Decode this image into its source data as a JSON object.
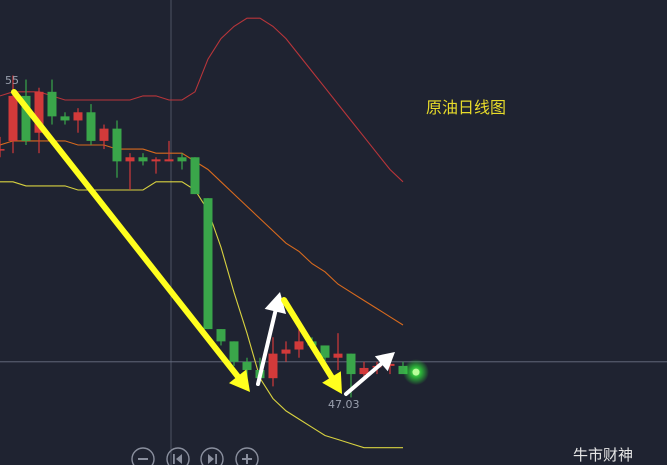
{
  "chart_data": {
    "type": "candlestick",
    "title": "原油日线图",
    "watermark": "牛市财神",
    "price_labels": {
      "high": "55",
      "low": "47.03"
    },
    "ylim": [
      45.5,
      56.5
    ],
    "colors": {
      "up": "#d23a3a",
      "down": "#3aa64a",
      "upper_band": "#b8353a",
      "mid_band": "#d86a1e",
      "lower_band": "#d8d240",
      "title": "#e8dc2a",
      "arrow_down": "#ffff1e",
      "arrow_up": "#ffffff",
      "glow": "#2fe03a"
    },
    "candles": [
      {
        "o": 53.1,
        "h": 53.4,
        "l": 52.9,
        "c": 53.1
      },
      {
        "o": 53.3,
        "h": 54.9,
        "l": 53.0,
        "c": 54.4
      },
      {
        "o": 54.4,
        "h": 54.8,
        "l": 53.2,
        "c": 53.3
      },
      {
        "o": 53.5,
        "h": 54.6,
        "l": 53.0,
        "c": 54.5
      },
      {
        "o": 54.5,
        "h": 54.8,
        "l": 53.7,
        "c": 53.9
      },
      {
        "o": 53.9,
        "h": 54.0,
        "l": 53.7,
        "c": 53.8
      },
      {
        "o": 53.8,
        "h": 54.1,
        "l": 53.5,
        "c": 54.0
      },
      {
        "o": 54.0,
        "h": 54.2,
        "l": 53.2,
        "c": 53.3
      },
      {
        "o": 53.3,
        "h": 53.7,
        "l": 53.1,
        "c": 53.6
      },
      {
        "o": 53.6,
        "h": 53.8,
        "l": 52.4,
        "c": 52.8
      },
      {
        "o": 52.8,
        "h": 53.0,
        "l": 52.1,
        "c": 52.9
      },
      {
        "o": 52.9,
        "h": 53.0,
        "l": 52.7,
        "c": 52.8
      },
      {
        "o": 52.8,
        "h": 52.9,
        "l": 52.5,
        "c": 52.85
      },
      {
        "o": 52.8,
        "h": 53.3,
        "l": 52.8,
        "c": 52.85
      },
      {
        "o": 52.9,
        "h": 53.0,
        "l": 52.6,
        "c": 52.8
      },
      {
        "o": 52.9,
        "h": 52.9,
        "l": 52.0,
        "c": 52.0
      },
      {
        "o": 51.9,
        "h": 51.9,
        "l": 48.7,
        "c": 48.7
      },
      {
        "o": 48.7,
        "h": 48.7,
        "l": 48.3,
        "c": 48.4
      },
      {
        "o": 48.4,
        "h": 48.4,
        "l": 47.8,
        "c": 47.9
      },
      {
        "o": 47.9,
        "h": 48.0,
        "l": 47.5,
        "c": 47.7
      },
      {
        "o": 47.7,
        "h": 48.0,
        "l": 47.4,
        "c": 47.5
      },
      {
        "o": 47.5,
        "h": 48.5,
        "l": 47.3,
        "c": 48.1
      },
      {
        "o": 48.1,
        "h": 48.4,
        "l": 47.9,
        "c": 48.2
      },
      {
        "o": 48.2,
        "h": 48.7,
        "l": 48.0,
        "c": 48.4
      },
      {
        "o": 48.4,
        "h": 48.5,
        "l": 48.2,
        "c": 48.3
      },
      {
        "o": 48.3,
        "h": 48.3,
        "l": 47.9,
        "c": 48.0
      },
      {
        "o": 48.0,
        "h": 48.6,
        "l": 47.7,
        "c": 48.1
      },
      {
        "o": 48.1,
        "h": 48.1,
        "l": 47.03,
        "c": 47.6
      },
      {
        "o": 47.6,
        "h": 47.9,
        "l": 47.5,
        "c": 47.75
      },
      {
        "o": 47.8,
        "h": 47.9,
        "l": 47.6,
        "c": 47.8
      },
      {
        "o": 47.8,
        "h": 47.85,
        "l": 47.6,
        "c": 47.85
      },
      {
        "o": 47.8,
        "h": 47.9,
        "l": 47.7,
        "c": 47.6
      }
    ],
    "bands": {
      "upper": [
        54.4,
        54.5,
        54.5,
        54.5,
        54.4,
        54.3,
        54.3,
        54.3,
        54.3,
        54.3,
        54.3,
        54.4,
        54.4,
        54.3,
        54.3,
        54.5,
        55.3,
        55.8,
        56.1,
        56.3,
        56.3,
        56.1,
        55.8,
        55.4,
        55.0,
        54.6,
        54.2,
        53.8,
        53.4,
        53.0,
        52.6,
        52.3
      ],
      "mid": [
        53.2,
        53.3,
        53.3,
        53.3,
        53.3,
        53.3,
        53.2,
        53.2,
        53.2,
        53.1,
        53.1,
        53.1,
        53.0,
        53.0,
        53.0,
        52.8,
        52.6,
        52.3,
        52.0,
        51.7,
        51.4,
        51.1,
        50.8,
        50.6,
        50.3,
        50.1,
        49.8,
        49.6,
        49.4,
        49.2,
        49.0,
        48.8
      ],
      "lower": [
        52.3,
        52.3,
        52.2,
        52.2,
        52.2,
        52.2,
        52.1,
        52.1,
        52.1,
        52.1,
        52.1,
        52.1,
        52.3,
        52.3,
        52.3,
        52.1,
        51.6,
        50.7,
        49.6,
        48.6,
        47.5,
        47.0,
        46.7,
        46.5,
        46.3,
        46.1,
        46.0,
        45.9,
        45.8,
        45.8,
        45.8,
        45.8
      ]
    },
    "current_price_line": 47.9
  },
  "toolbar": {
    "buttons": [
      {
        "icon": "minus-icon"
      },
      {
        "icon": "step-back-icon"
      },
      {
        "icon": "step-forward-icon"
      },
      {
        "icon": "plus-icon"
      }
    ]
  }
}
